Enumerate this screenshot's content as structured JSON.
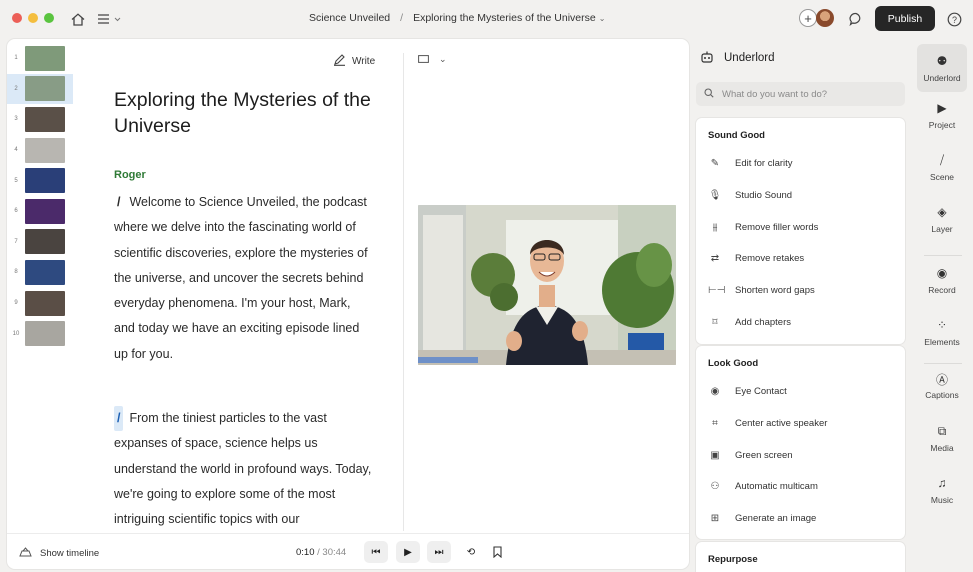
{
  "titlebar": {
    "crumb_project": "Science Unveiled",
    "crumb_separator": "/",
    "crumb_file": "Exploring the Mysteries of the Universe",
    "publish_label": "Publish",
    "traffic_colors": [
      "#ec5f57",
      "#f4be3e",
      "#5ac43f"
    ]
  },
  "editor": {
    "write_label": "Write",
    "thumbnails": [
      {
        "num": "1",
        "color": "#7f9a7a"
      },
      {
        "num": "2",
        "color": "#889c86",
        "active": true
      },
      {
        "num": "3",
        "color": "#5a5048"
      },
      {
        "num": "4",
        "color": "#b8b6b1"
      },
      {
        "num": "5",
        "color": "#2a3f78"
      },
      {
        "num": "6",
        "color": "#4b2a6a"
      },
      {
        "num": "7",
        "color": "#4a4440"
      },
      {
        "num": "8",
        "color": "#2e4a80"
      },
      {
        "num": "9",
        "color": "#5a4e46"
      },
      {
        "num": "10",
        "color": "#a8a6a0"
      }
    ],
    "doc_title": "Exploring the Mysteries of the Universe",
    "speaker": "Roger",
    "marker": "/",
    "paragraph1": "Welcome to Science Unveiled, the podcast where we delve into the fascinating world of scientific discoveries, explore the mysteries of the universe, and uncover the secrets behind everyday phenomena. I'm your host, Mark, and today we have an exciting episode lined up for you.",
    "paragraph2": "From the tiniest particles to the vast expanses of space, science helps us understand the world in profound ways. Today, we're going to explore some of the most intriguing scientific topics with our"
  },
  "bottombar": {
    "show_timeline": "Show timeline",
    "time_current": "0:10",
    "time_sep": " / ",
    "time_total": "30:44"
  },
  "underlord": {
    "title": "Underlord",
    "search_placeholder": "What do you want to do?",
    "sections": [
      {
        "title": "Sound Good",
        "items": [
          {
            "icon": "edit-clarity-icon",
            "glyph": "✎",
            "label": "Edit for clarity"
          },
          {
            "icon": "studio-sound-icon",
            "glyph": "🎙",
            "label": "Studio Sound"
          },
          {
            "icon": "filler-words-icon",
            "glyph": "⫵",
            "label": "Remove filler words"
          },
          {
            "icon": "retakes-icon",
            "glyph": "⇄",
            "label": "Remove retakes"
          },
          {
            "icon": "word-gaps-icon",
            "glyph": "⊢⊣",
            "label": "Shorten word gaps"
          },
          {
            "icon": "chapters-icon",
            "glyph": "⌑",
            "label": "Add chapters"
          }
        ]
      },
      {
        "title": "Look Good",
        "items": [
          {
            "icon": "eye-icon",
            "glyph": "◉",
            "label": "Eye Contact"
          },
          {
            "icon": "center-speaker-icon",
            "glyph": "⌗",
            "label": "Center active speaker"
          },
          {
            "icon": "green-screen-icon",
            "glyph": "▣",
            "label": "Green screen"
          },
          {
            "icon": "multicam-icon",
            "glyph": "⚇",
            "label": "Automatic multicam"
          },
          {
            "icon": "generate-image-icon",
            "glyph": "⊞",
            "label": "Generate an image"
          }
        ]
      },
      {
        "title": "Repurpose",
        "items": []
      }
    ]
  },
  "rail": [
    {
      "label": "Underlord",
      "icon": "robot-icon",
      "glyph": "⚉",
      "active": true
    },
    {
      "label": "Project",
      "icon": "project-icon",
      "glyph": "▶"
    },
    {
      "label": "Scene",
      "icon": "scene-icon",
      "glyph": "⧸"
    },
    {
      "label": "Layer",
      "icon": "layer-icon",
      "glyph": "◈"
    },
    {
      "label": "Record",
      "icon": "record-icon",
      "glyph": "◉"
    },
    {
      "label": "Elements",
      "icon": "elements-icon",
      "glyph": "⁘"
    },
    {
      "label": "Captions",
      "icon": "captions-icon",
      "glyph": "Ⓐ"
    },
    {
      "label": "Media",
      "icon": "media-icon",
      "glyph": "⧉"
    },
    {
      "label": "Music",
      "icon": "music-icon",
      "glyph": "♫"
    }
  ]
}
